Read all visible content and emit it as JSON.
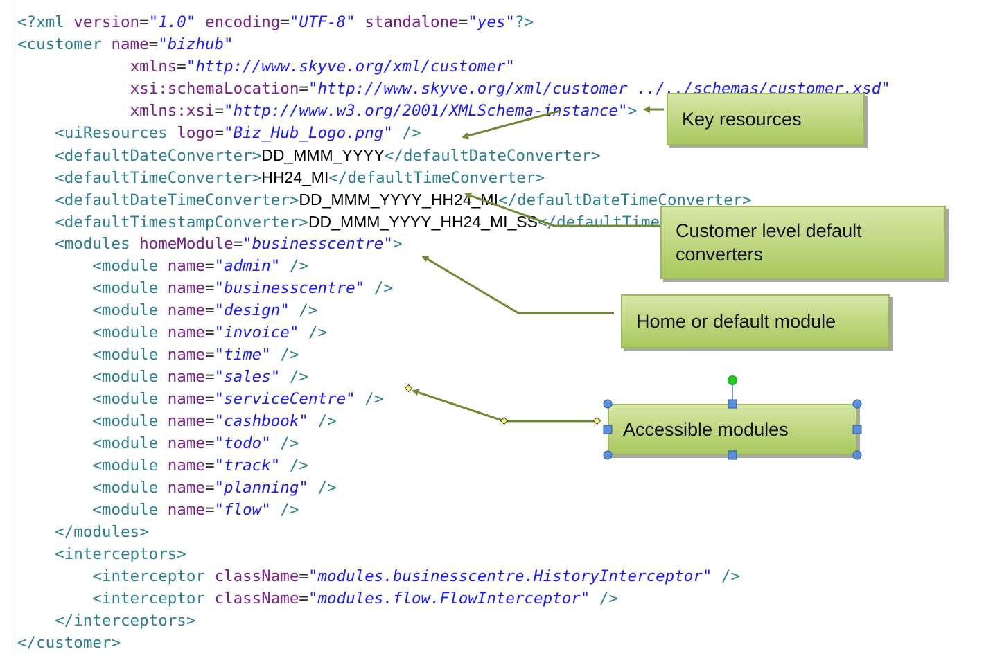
{
  "code": {
    "l1": {
      "open": "<?",
      "tag": "xml",
      "a1": "version",
      "v1": "\"1.0\"",
      "a2": "encoding",
      "v2": "\"UTF-8\"",
      "a3": "standalone",
      "v3": "\"yes\"",
      "close": "?>"
    },
    "l2": {
      "open": "<",
      "tag": "customer",
      "a1": "name",
      "v1": "\"bizhub\""
    },
    "l3": {
      "a1": "xmlns",
      "v1": "\"http://www.skyve.org/xml/customer\""
    },
    "l4": {
      "a1": "xsi:schemaLocation",
      "v1": "\"http://www.skyve.org/xml/customer ../../schemas/customer.xsd\""
    },
    "l5": {
      "a1": "xmlns:xsi",
      "v1": "\"http://www.w3.org/2001/XMLSchema-instance\"",
      "close": ">"
    },
    "l6": {
      "open": "<",
      "tag": "uiResources",
      "a1": "logo",
      "v1": "\"Biz_Hub_Logo.png\"",
      "close": " />"
    },
    "l7": {
      "open": "<defaultDateConverter>",
      "text": "DD_MMM_YYYY",
      "close": "</defaultDateConverter>"
    },
    "l8": {
      "open": "<defaultTimeConverter>",
      "text": "HH24_MI",
      "close": "</defaultTimeConverter>"
    },
    "l9": {
      "open": "<defaultDateTimeConverter>",
      "text": "DD_MMM_YYYY_HH24_MI",
      "close": "</defaultDateTimeConverter>"
    },
    "l10": {
      "open": "<defaultTimestampConverter>",
      "text": "DD_MMM_YYYY_HH24_MI_SS",
      "close": "</defaultTimestampConverter>"
    },
    "l11": {
      "open": "<",
      "tag": "modules",
      "a1": "homeModule",
      "v1": "\"businesscentre\"",
      "close": ">"
    },
    "module_tag": "<module",
    "module_attr": "name",
    "selfclose": " />",
    "modules": [
      "\"admin\"",
      "\"businesscentre\"",
      "\"design\"",
      "\"invoice\"",
      "\"time\"",
      "\"sales\"",
      "\"serviceCentre\"",
      "\"cashbook\"",
      "\"todo\"",
      "\"track\"",
      "\"planning\"",
      "\"flow\""
    ],
    "l24": "</modules>",
    "l25": "<interceptors>",
    "interceptor_tag": "<interceptor",
    "interceptor_attr": "className",
    "interceptors": [
      "\"modules.businesscentre.HistoryInterceptor\"",
      "\"modules.flow.FlowInterceptor\""
    ],
    "l28": "</interceptors>",
    "l29": "</customer>"
  },
  "callouts": {
    "key_resources": "Key resources",
    "converters_line1": "Customer level default",
    "converters_line2": "converters",
    "home_module": "Home or default module",
    "accessible_modules": "Accessible modules"
  },
  "colors": {
    "tag": "#2a7f8f",
    "attribute": "#7a1f8a",
    "value": "#1a1aff",
    "callout_fill": "#b7d275",
    "arrow": "#6e8a35",
    "selection_handle": "#4a7fd0",
    "rotate_handle": "#22cc22"
  }
}
